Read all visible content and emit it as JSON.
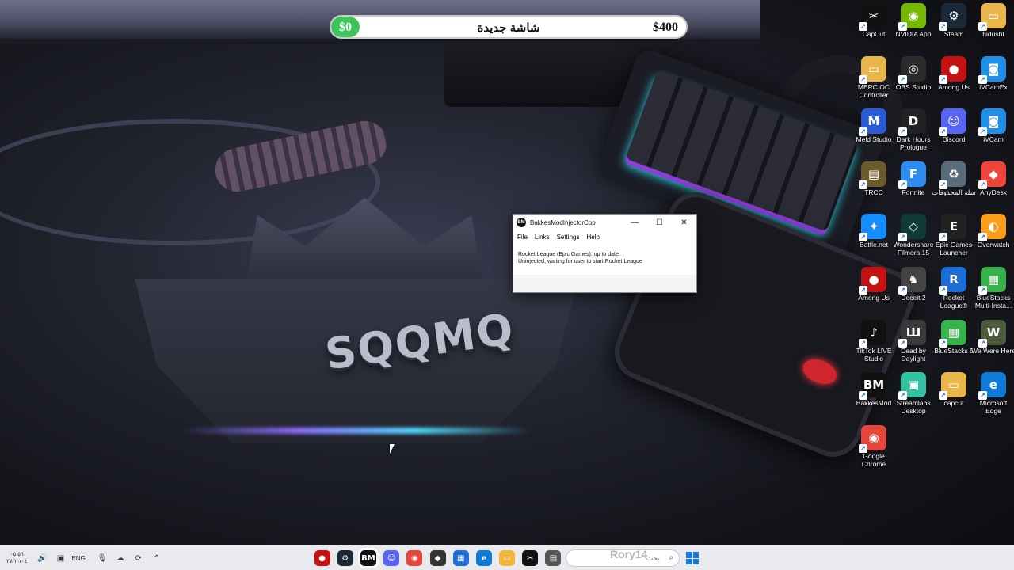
{
  "topbar": {
    "left_value": "$0",
    "title": "شاشة جديدة",
    "right_value": "$400",
    "fill_fraction": 0.08
  },
  "wallpaper": {
    "logo_text": "SQQMQ"
  },
  "desktop_icons": [
    {
      "label": "CapCut",
      "icon": "capcut-icon",
      "color": "#111111",
      "glyph": "✂"
    },
    {
      "label": "NVIDIA App",
      "icon": "nvidia-icon",
      "color": "#76b900",
      "glyph": "◉"
    },
    {
      "label": "Steam",
      "icon": "steam-icon",
      "color": "#1b2838",
      "glyph": "⚙"
    },
    {
      "label": "hidusbf",
      "icon": "folder-icon",
      "color": "#e8b64b",
      "glyph": "▭"
    },
    {
      "label": "MERC OC Controller",
      "icon": "folder-icon",
      "color": "#e8b64b",
      "glyph": "▭"
    },
    {
      "label": "OBS Studio",
      "icon": "obs-icon",
      "color": "#2b2b2b",
      "glyph": "◎"
    },
    {
      "label": "Among Us",
      "icon": "among-us-icon",
      "color": "#c51111",
      "glyph": "●"
    },
    {
      "label": "iVCamEx",
      "icon": "ivcam-icon",
      "color": "#1f8fe8",
      "glyph": "◙"
    },
    {
      "label": "Meld Studio",
      "icon": "meld-icon",
      "color": "#2a5bd7",
      "glyph": "M"
    },
    {
      "label": "Dark Hours Prologue",
      "icon": "dark-hours-icon",
      "color": "#222222",
      "glyph": "D"
    },
    {
      "label": "Discord",
      "icon": "discord-icon",
      "color": "#5865f2",
      "glyph": "☺"
    },
    {
      "label": "iVCam",
      "icon": "ivcam-icon",
      "color": "#1f8fe8",
      "glyph": "◙"
    },
    {
      "label": "TRCC",
      "icon": "trcc-icon",
      "color": "#6b5a2a",
      "glyph": "▤"
    },
    {
      "label": "Fortnite",
      "icon": "fortnite-icon",
      "color": "#2d8cf0",
      "glyph": "F"
    },
    {
      "label": "سلة المحذوفات",
      "icon": "recycle-bin-icon",
      "color": "#5c6b7a",
      "glyph": "♻"
    },
    {
      "label": "AnyDesk",
      "icon": "anydesk-icon",
      "color": "#ef443b",
      "glyph": "◆"
    },
    {
      "label": "Battle.net",
      "icon": "battlenet-icon",
      "color": "#148eff",
      "glyph": "✦"
    },
    {
      "label": "Wondershare Filmora 15",
      "icon": "filmora-icon",
      "color": "#0f3d36",
      "glyph": "◇"
    },
    {
      "label": "Epic Games Launcher",
      "icon": "epic-games-icon",
      "color": "#222222",
      "glyph": "E"
    },
    {
      "label": "Overwatch",
      "icon": "overwatch-icon",
      "color": "#f99e1a",
      "glyph": "◐"
    },
    {
      "label": "Among Us",
      "icon": "among-us-icon",
      "color": "#c51111",
      "glyph": "●"
    },
    {
      "label": "Deceit 2",
      "icon": "deceit-icon",
      "color": "#444444",
      "glyph": "♞"
    },
    {
      "label": "Rocket League®",
      "icon": "rocket-league-icon",
      "color": "#1a6ed8",
      "glyph": "R"
    },
    {
      "label": "BlueStacks Multi-Insta...",
      "icon": "bluestacks-icon",
      "color": "#38b24a",
      "glyph": "▦"
    },
    {
      "label": "TikTok LIVE Studio",
      "icon": "tiktok-icon",
      "color": "#111111",
      "glyph": "♪"
    },
    {
      "label": "Dead by Daylight",
      "icon": "dbd-icon",
      "color": "#3a3a3a",
      "glyph": "Ш"
    },
    {
      "label": "BlueStacks 5",
      "icon": "bluestacks-icon",
      "color": "#38b24a",
      "glyph": "▦"
    },
    {
      "label": "We Were Here",
      "icon": "we-were-here-icon",
      "color": "#4a5a3a",
      "glyph": "W"
    },
    {
      "label": "BakkesMod",
      "icon": "bakkesmod-icon",
      "color": "#111111",
      "glyph": "BM"
    },
    {
      "label": "Streamlabs Desktop",
      "icon": "streamlabs-icon",
      "color": "#31c3a2",
      "glyph": "▣"
    },
    {
      "label": "capcut",
      "icon": "folder-icon",
      "color": "#e8b64b",
      "glyph": "▭"
    },
    {
      "label": "Microsoft Edge",
      "icon": "edge-icon",
      "color": "#0f7ad8",
      "glyph": "e"
    },
    {
      "label": "Google Chrome",
      "icon": "chrome-icon",
      "color": "#e8453c",
      "glyph": "◉"
    }
  ],
  "window": {
    "title": "BakkesModInjectorCpp",
    "app_badge": "BM",
    "menu": [
      "File",
      "Links",
      "Settings",
      "Help"
    ],
    "status_line1": "Rocket League (Epic Games): up to date.",
    "status_line2": "Uninjected, waiting for user to start Rocket League",
    "minimize_glyph": "—",
    "maximize_glyph": "☐",
    "close_glyph": "✕"
  },
  "taskbar": {
    "clock_time": "٠٥:٥٦",
    "clock_date": "٢٧/١٠/٠٤",
    "language": "ENG",
    "search_placeholder": "بحث",
    "search_overlay": "Rory14",
    "apps": [
      {
        "icon": "among-us-icon",
        "color": "#c51111",
        "glyph": "●",
        "active": false
      },
      {
        "icon": "steam-icon",
        "color": "#1b2838",
        "glyph": "⚙",
        "active": false
      },
      {
        "icon": "bakkesmod-icon",
        "color": "#111111",
        "glyph": "BM",
        "active": true
      },
      {
        "icon": "discord-icon",
        "color": "#5865f2",
        "glyph": "☺",
        "active": false
      },
      {
        "icon": "chrome-icon",
        "color": "#e8453c",
        "glyph": "◉",
        "active": false
      },
      {
        "icon": "epic-games-icon",
        "color": "#333333",
        "glyph": "◆",
        "active": false
      },
      {
        "icon": "store-icon",
        "color": "#1c6fd8",
        "glyph": "▦",
        "active": false
      },
      {
        "icon": "edge-icon",
        "color": "#0f7ad8",
        "glyph": "e",
        "active": false
      },
      {
        "icon": "file-explorer-icon",
        "color": "#f2b63c",
        "glyph": "▭",
        "active": false
      },
      {
        "icon": "capcut-icon",
        "color": "#111111",
        "glyph": "✂",
        "active": false
      },
      {
        "icon": "notepad-icon",
        "color": "#555555",
        "glyph": "▤",
        "active": false
      }
    ]
  }
}
